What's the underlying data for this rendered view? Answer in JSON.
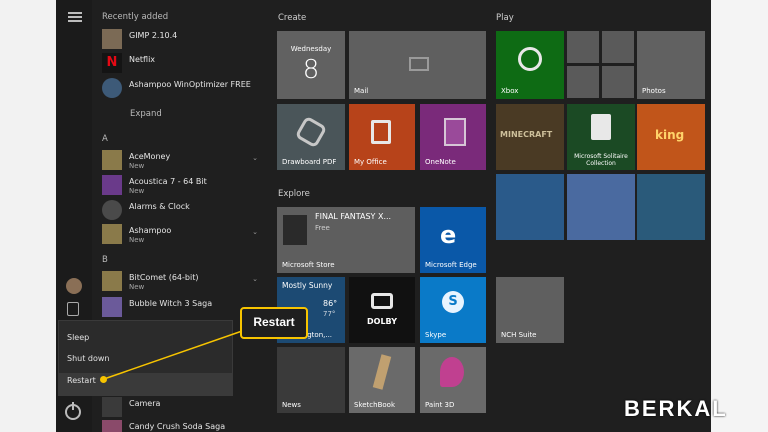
{
  "apps": {
    "recently_added": "Recently added",
    "expand": "Expand",
    "section_a": "A",
    "section_b": "B",
    "items": [
      {
        "name": "GIMP 2.10.4",
        "sub": ""
      },
      {
        "name": "Netflix",
        "sub": ""
      },
      {
        "name": "Ashampoo WinOptimizer FREE",
        "sub": ""
      },
      {
        "name": "AceMoney",
        "sub": "New"
      },
      {
        "name": "Acoustica 7 - 64 Bit",
        "sub": "New"
      },
      {
        "name": "Alarms & Clock",
        "sub": ""
      },
      {
        "name": "Ashampoo",
        "sub": "New"
      },
      {
        "name": "BitComet (64-bit)",
        "sub": "New"
      },
      {
        "name": "Bubble Witch 3 Saga",
        "sub": ""
      },
      {
        "name": "Camera",
        "sub": ""
      },
      {
        "name": "Candy Crush Soda Saga",
        "sub": ""
      }
    ]
  },
  "power_menu": {
    "sleep": "Sleep",
    "shutdown": "Shut down",
    "restart": "Restart"
  },
  "callout": {
    "label": "Restart"
  },
  "groups": {
    "create": "Create",
    "play": "Play",
    "explore": "Explore"
  },
  "tiles": {
    "calendar_day": "Wednesday",
    "calendar_date": "8",
    "mail": "Mail",
    "xbox": "Xbox",
    "photos": "Photos",
    "drawboard": "Drawboard PDF",
    "myoffice": "My Office",
    "onenote": "OneNote",
    "minecraft": "MINECRAFT",
    "solitaire": "Microsoft Solitaire Collection",
    "king": "king",
    "ms_store_title": "FINAL FANTASY X...",
    "ms_store_sub": "Free",
    "ms_store": "Microsoft Store",
    "edge": "Microsoft Edge",
    "weather_cond": "Mostly Sunny",
    "weather_hi": "86°",
    "weather_lo": "77°",
    "weather_loc": "Washington,...",
    "dolby": "DOLBY",
    "skype": "Skype",
    "nch": "NCH Suite",
    "news": "News",
    "sketchbook": "SketchBook",
    "paint3d": "Paint 3D"
  },
  "brand": "BERKAL",
  "colors": {
    "accent": "#f7c400",
    "tile_gray": "#6a6a6a"
  }
}
